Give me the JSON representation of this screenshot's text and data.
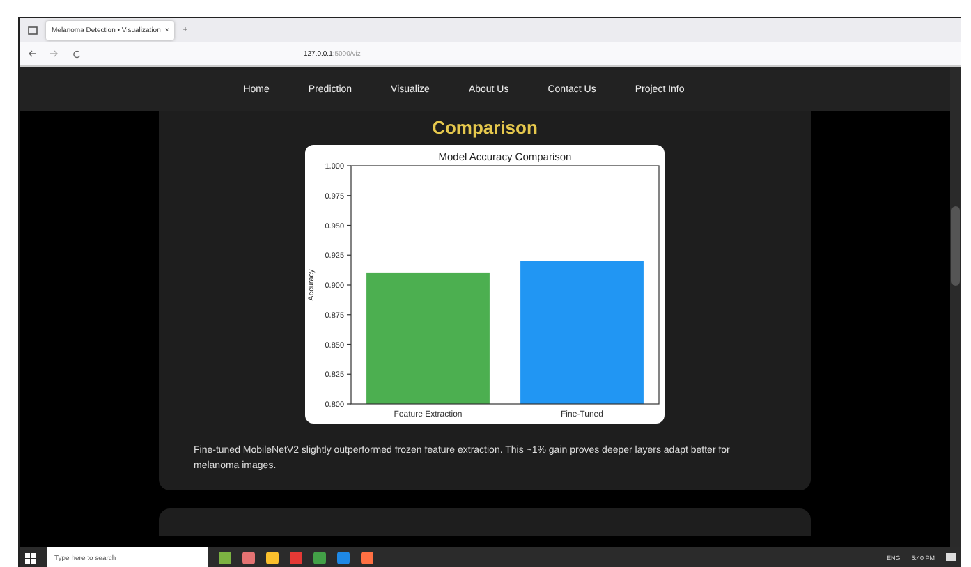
{
  "browser": {
    "tab_title": "Melanoma Detection • Visualization",
    "tab_close": "×",
    "new_tab": "+",
    "url_host": "127.0.0.1",
    "url_path": ":5000/viz"
  },
  "nav": {
    "items": [
      {
        "label": "Home"
      },
      {
        "label": "Prediction"
      },
      {
        "label": "Visualize"
      },
      {
        "label": "About Us"
      },
      {
        "label": "Contact Us"
      },
      {
        "label": "Project Info"
      }
    ]
  },
  "section": {
    "heading": "Comparison",
    "chart_data": {
      "type": "bar",
      "title": "Model Accuracy Comparison",
      "ylabel": "Accuracy",
      "categories": [
        "Feature Extraction",
        "Fine-Tuned"
      ],
      "values": [
        0.91,
        0.92
      ],
      "colors": [
        "#4caf50",
        "#2196f3"
      ],
      "ylim": [
        0.8,
        1.0
      ],
      "yticks": [
        {
          "value": 0.8,
          "label": "0.800"
        },
        {
          "value": 0.825,
          "label": "0.825"
        },
        {
          "value": 0.85,
          "label": "0.850"
        },
        {
          "value": 0.875,
          "label": "0.875"
        },
        {
          "value": 0.9,
          "label": "0.900"
        },
        {
          "value": 0.925,
          "label": "0.925"
        },
        {
          "value": 0.95,
          "label": "0.950"
        },
        {
          "value": 0.975,
          "label": "0.975"
        },
        {
          "value": 1.0,
          "label": "1.000"
        }
      ]
    },
    "caption": "Fine-tuned MobileNetV2 slightly outperformed frozen feature extraction. This ~1% gain proves deeper layers adapt better for melanoma images."
  },
  "taskbar": {
    "search_placeholder": "Type here to search",
    "language": "ENG",
    "time": "5:40 PM"
  }
}
